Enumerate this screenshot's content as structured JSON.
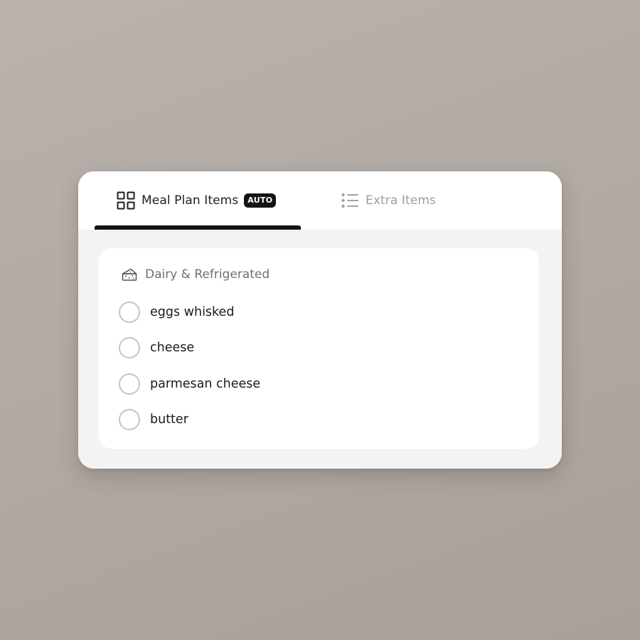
{
  "tabs": {
    "meal_plan": {
      "label": "Meal Plan Items",
      "badge": "AUTO",
      "icon": "grid-icon",
      "active": true
    },
    "extra": {
      "label": "Extra Items",
      "icon": "list-icon",
      "active": false
    }
  },
  "section": {
    "title": "Dairy & Refrigerated",
    "icon": "cheese-icon",
    "items": [
      {
        "label": "eggs whisked",
        "checked": false
      },
      {
        "label": "cheese",
        "checked": false
      },
      {
        "label": "parmesan cheese",
        "checked": false
      },
      {
        "label": "butter",
        "checked": false
      }
    ]
  },
  "colors": {
    "accent": "#141414",
    "inactive_text": "#9c9ca2",
    "background": "#b3aba5",
    "panel": "#f3f3f3"
  }
}
